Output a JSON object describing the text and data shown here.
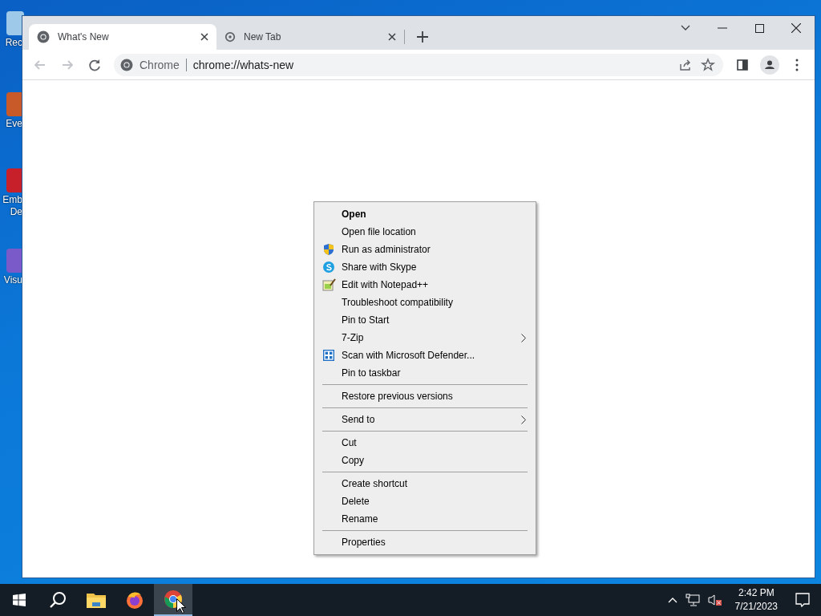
{
  "desktop_icons": [
    {
      "label": "Rec"
    },
    {
      "label": "Eve"
    },
    {
      "label": "Emb\nDe"
    },
    {
      "label": "Visu"
    }
  ],
  "browser": {
    "tabs": [
      {
        "title": "What's New",
        "selected": true
      },
      {
        "title": "New Tab",
        "selected": false
      }
    ],
    "address_chip": "Chrome",
    "url": "chrome://whats-new"
  },
  "context_menu": [
    {
      "kind": "item",
      "label": "Open",
      "default": true,
      "submenu": false
    },
    {
      "kind": "item",
      "label": "Open file location",
      "default": false,
      "submenu": false
    },
    {
      "kind": "item",
      "label": "Run as administrator",
      "default": false,
      "submenu": false
    },
    {
      "kind": "item",
      "label": "Share with Skype",
      "default": false,
      "submenu": false
    },
    {
      "kind": "item",
      "label": "Edit with Notepad++",
      "default": false,
      "submenu": false
    },
    {
      "kind": "item",
      "label": "Troubleshoot compatibility",
      "default": false,
      "submenu": false
    },
    {
      "kind": "item",
      "label": "Pin to Start",
      "default": false,
      "submenu": false
    },
    {
      "kind": "item",
      "label": "7-Zip",
      "default": false,
      "submenu": true
    },
    {
      "kind": "item",
      "label": "Scan with Microsoft Defender...",
      "default": false,
      "submenu": false
    },
    {
      "kind": "item",
      "label": "Pin to taskbar",
      "default": false,
      "submenu": false
    },
    {
      "kind": "separator"
    },
    {
      "kind": "item",
      "label": "Restore previous versions",
      "default": false,
      "submenu": false
    },
    {
      "kind": "separator"
    },
    {
      "kind": "item",
      "label": "Send to",
      "default": false,
      "submenu": true
    },
    {
      "kind": "separator"
    },
    {
      "kind": "item",
      "label": "Cut",
      "default": false,
      "submenu": false
    },
    {
      "kind": "item",
      "label": "Copy",
      "default": false,
      "submenu": false
    },
    {
      "kind": "separator"
    },
    {
      "kind": "item",
      "label": "Create shortcut",
      "default": false,
      "submenu": false
    },
    {
      "kind": "item",
      "label": "Delete",
      "default": false,
      "submenu": false
    },
    {
      "kind": "item",
      "label": "Rename",
      "default": false,
      "submenu": false
    },
    {
      "kind": "separator"
    },
    {
      "kind": "item",
      "label": "Properties",
      "default": false,
      "submenu": false
    }
  ],
  "taskbar": {
    "apps": [
      {
        "kind": "start",
        "selected": false
      },
      {
        "kind": "search",
        "selected": false
      },
      {
        "kind": "explorer",
        "selected": false
      },
      {
        "kind": "firefox",
        "selected": false
      },
      {
        "kind": "chrome",
        "selected": true
      }
    ],
    "time": "2:42 PM",
    "date": "7/21/2023"
  }
}
